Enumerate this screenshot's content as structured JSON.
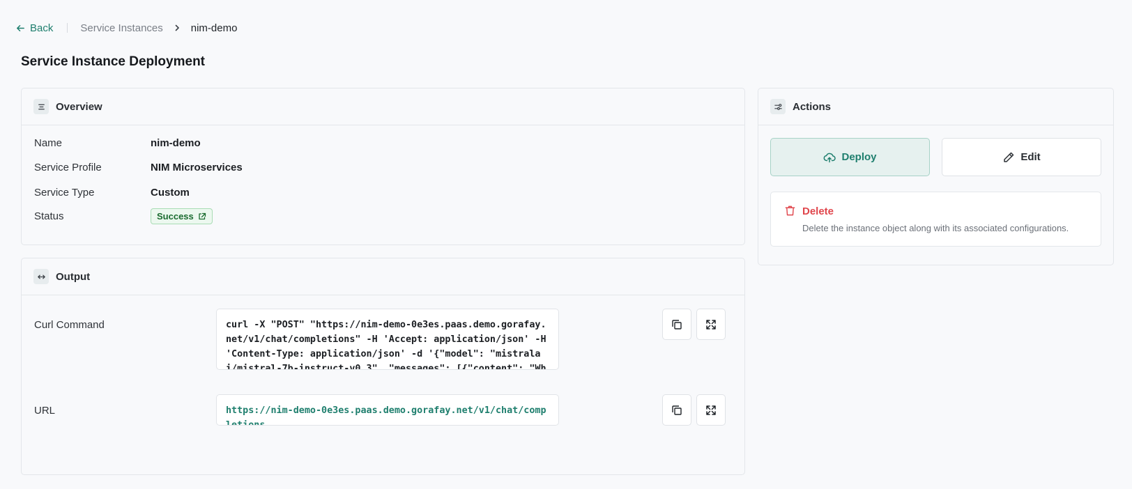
{
  "nav": {
    "back_label": "Back",
    "breadcrumb": {
      "parent": "Service Instances",
      "current": "nim-demo"
    }
  },
  "page": {
    "title": "Service Instance Deployment"
  },
  "overview": {
    "title": "Overview",
    "icon": "align-center-icon",
    "fields": {
      "name": {
        "label": "Name",
        "value": "nim-demo"
      },
      "service_profile": {
        "label": "Service Profile",
        "value": "NIM Microservices"
      },
      "service_type": {
        "label": "Service Type",
        "value": "Custom"
      },
      "status": {
        "label": "Status",
        "value": "Success",
        "icon": "external-link-icon",
        "color": "#1a6b2f"
      }
    }
  },
  "output": {
    "title": "Output",
    "icon": "code-arrows-icon",
    "curl": {
      "label": "Curl Command",
      "value": "curl -X \"POST\" \"https://nim-demo-0e3es.paas.demo.gorafay.net/v1/chat/completions\" -H 'Accept: application/json' -H 'Content-Type: application/json' -d '{\"model\": \"mistralai/mistral-7b-instruct-v0.3\", \"messages\": [{\"content\": \"What"
    },
    "url": {
      "label": "URL",
      "value": "https://nim-demo-0e3es.paas.demo.gorafay.net/v1/chat/completions"
    },
    "copy_icon": "copy-icon",
    "expand_icon": "expand-icon"
  },
  "actions": {
    "title": "Actions",
    "icon": "sliders-icon",
    "deploy_label": "Deploy",
    "edit_label": "Edit",
    "delete": {
      "label": "Delete",
      "description": "Delete the instance object along with its associated configurations.",
      "color": "#e0464c"
    }
  },
  "colors": {
    "accent": "#1f7f6e",
    "background": "#f8f9fb",
    "danger": "#e0464c",
    "success": "#1a6b2f"
  }
}
